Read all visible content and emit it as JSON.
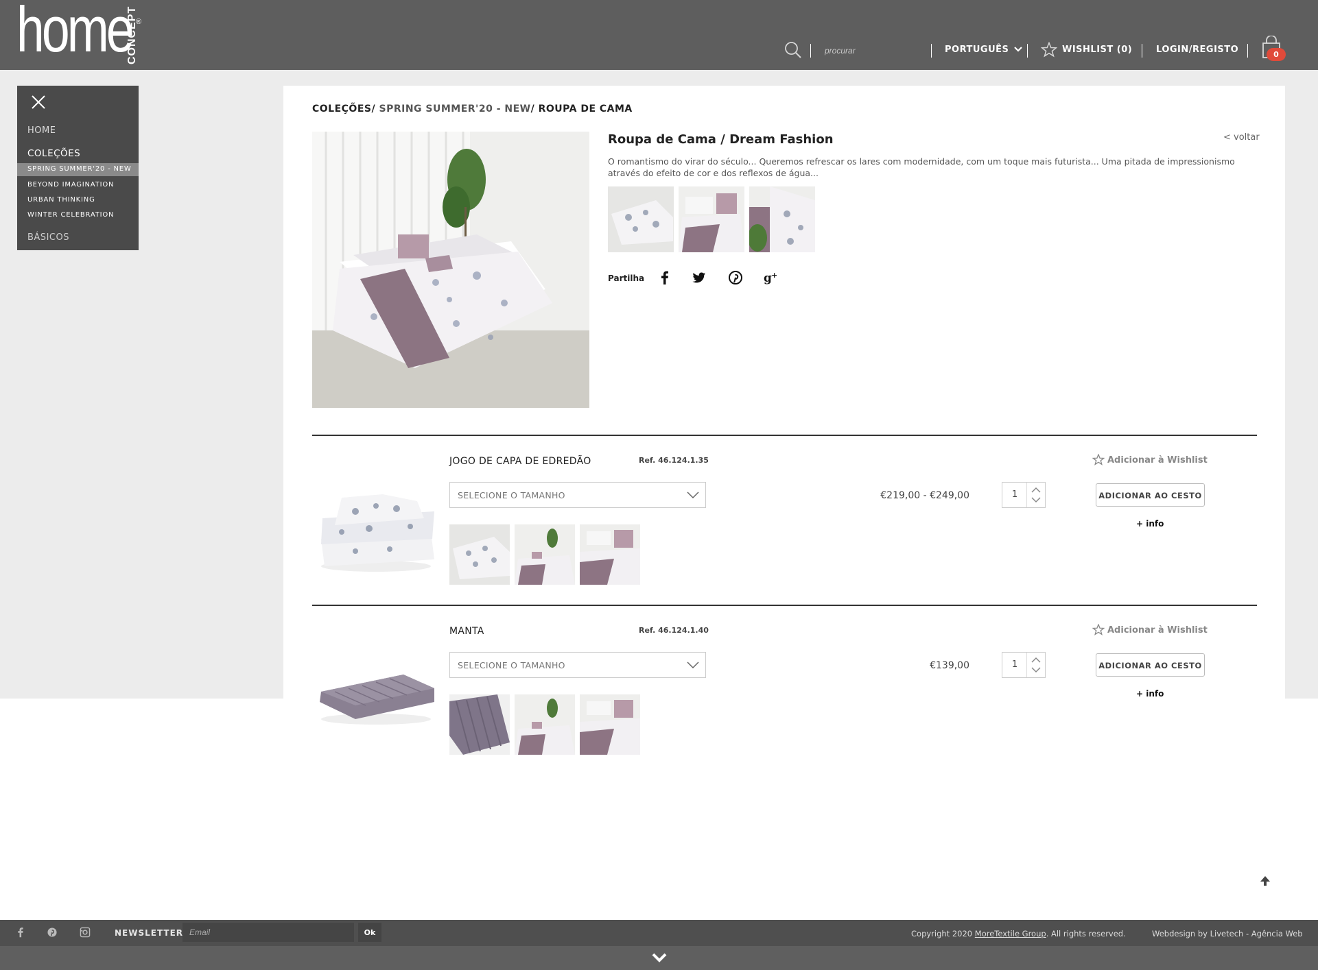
{
  "header": {
    "logo_text": "home",
    "logo_sub": "CONCEPT",
    "logo_reg": "®",
    "search_placeholder": "procurar",
    "language": "PORTUGUÊS",
    "wishlist": "WISHLIST (0)",
    "login": "LOGIN/REGISTO",
    "cart_count": "0"
  },
  "sidebar": {
    "items": [
      {
        "label": "HOME"
      },
      {
        "label": "COLEÇÕES"
      }
    ],
    "sub_items": [
      {
        "label": "SPRING SUMMER'20 - NEW",
        "active": true
      },
      {
        "label": "BEYOND IMAGINATION"
      },
      {
        "label": "URBAN THINKING"
      },
      {
        "label": "WINTER CELEBRATION"
      }
    ],
    "bottom_item": "BÁSICOS"
  },
  "breadcrumb": {
    "part1": "COLEÇÕES/",
    "part2": " SPRING SUMMER'20 - NEW",
    "part3": "/ ROUPA DE CAMA"
  },
  "product": {
    "title": "Roupa de Cama / Dream Fashion",
    "back": "< voltar",
    "description": "O romantismo do virar do século... Queremos refrescar os lares com modernidade, com um toque mais futurista... Uma pitada de impressionismo através do efeito de cor e dos reflexos de água...",
    "share_label": "Partilha"
  },
  "items": [
    {
      "name": "JOGO DE CAPA DE EDREDÃO",
      "ref": "Ref. 46.124.1.35",
      "select_placeholder": "SELECIONE O TAMANHO",
      "price": "€219,00 - €249,00",
      "qty": "1",
      "wishlist": "Adicionar à Wishlist",
      "add_to_cart": "ADICIONAR AO CESTO",
      "info": "+ info"
    },
    {
      "name": "MANTA",
      "ref": "Ref. 46.124.1.40",
      "select_placeholder": "SELECIONE O TAMANHO",
      "price": "€139,00",
      "qty": "1",
      "wishlist": "Adicionar à Wishlist",
      "add_to_cart": "ADICIONAR AO CESTO",
      "info": "+ info"
    }
  ],
  "footer": {
    "newsletter_label": "NEWSLETTER",
    "email_placeholder": "Email",
    "ok": "Ok",
    "copyright_prefix": "Copyright 2020 ",
    "copyright_link": "MoreTextile Group",
    "copyright_suffix": ". All rights reserved.",
    "webdesign": "Webdesign by Livetech - Agência Web"
  },
  "colors": {
    "header_bg": "#5e5e5e",
    "sidebar_bg": "#4a4a4a",
    "page_bg": "#ececec",
    "badge": "#e04a3a",
    "footer_bg": "#4f4f4f"
  }
}
